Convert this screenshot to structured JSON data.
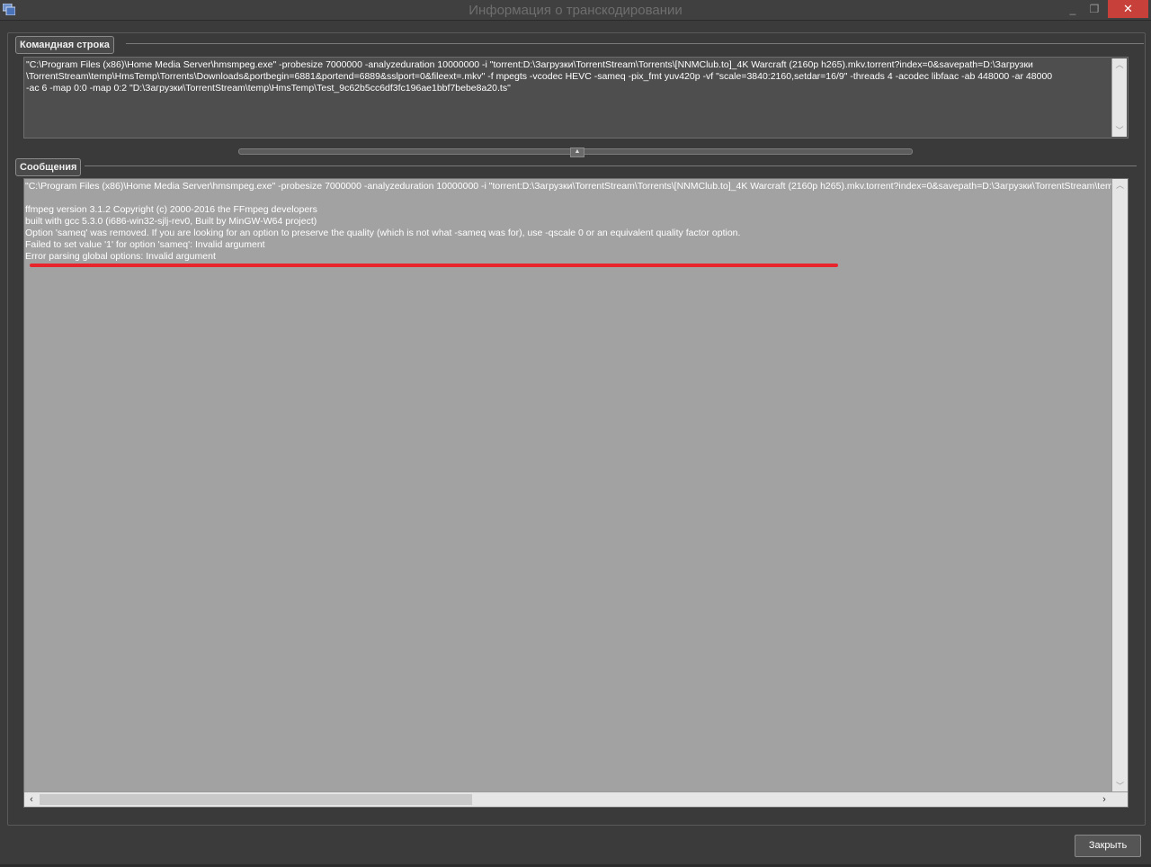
{
  "window": {
    "title": "Информация о транскодировании",
    "app_icon": "app-window-icon",
    "min_glyph": "_",
    "max_glyph": "❐",
    "close_glyph": "✕"
  },
  "command_group": {
    "label": "Командная строка",
    "text": "\"C:\\Program Files (x86)\\Home Media Server\\hmsmpeg.exe\" -probesize 7000000 -analyzeduration 10000000 -i \"torrent:D:\\Загрузки\\TorrentStream\\Torrents\\[NNMClub.to]_4K Warcraft (2160p h265).mkv.torrent?index=0&savepath=D:\\Загрузки\n\\TorrentStream\\temp\\HmsTemp\\Torrents\\Downloads&portbegin=6881&portend=6889&sslport=0&fileext=.mkv\" -f mpegts -vcodec HEVC -sameq -pix_fmt yuv420p -vf \"scale=3840:2160,setdar=16/9\" -threads 4 -acodec libfaac -ab 448000 -ar 48000\n-ac 6 -map 0:0 -map 0:2 \"D:\\Загрузки\\TorrentStream\\temp\\HmsTemp\\Test_9c62b5cc6df3fc196ae1bbf7bebe8a20.ts\""
  },
  "messages_group": {
    "label": "Сообщения",
    "text": "\"C:\\Program Files (x86)\\Home Media Server\\hmsmpeg.exe\" -probesize 7000000 -analyzeduration 10000000 -i \"torrent:D:\\Загрузки\\TorrentStream\\Torrents\\[NNMClub.to]_4K Warcraft (2160p h265).mkv.torrent?index=0&savepath=D:\\Загрузки\\TorrentStream\\temp\\HmsTemp\\Torrents\\Downloads\n\nffmpeg version 3.1.2 Copyright (c) 2000-2016 the FFmpeg developers\nbuilt with gcc 5.3.0 (i686-win32-sjlj-rev0, Built by MinGW-W64 project)\nOption 'sameq' was removed. If you are looking for an option to preserve the quality (which is not what -sameq was for), use -qscale 0 or an equivalent quality factor option.\nFailed to set value '1' for option 'sameq': Invalid argument\nError parsing global options: Invalid argument"
  },
  "footer": {
    "close_label": "Закрыть"
  },
  "colors": {
    "highlight": "#e8242c",
    "close_button": "#c7403a"
  }
}
